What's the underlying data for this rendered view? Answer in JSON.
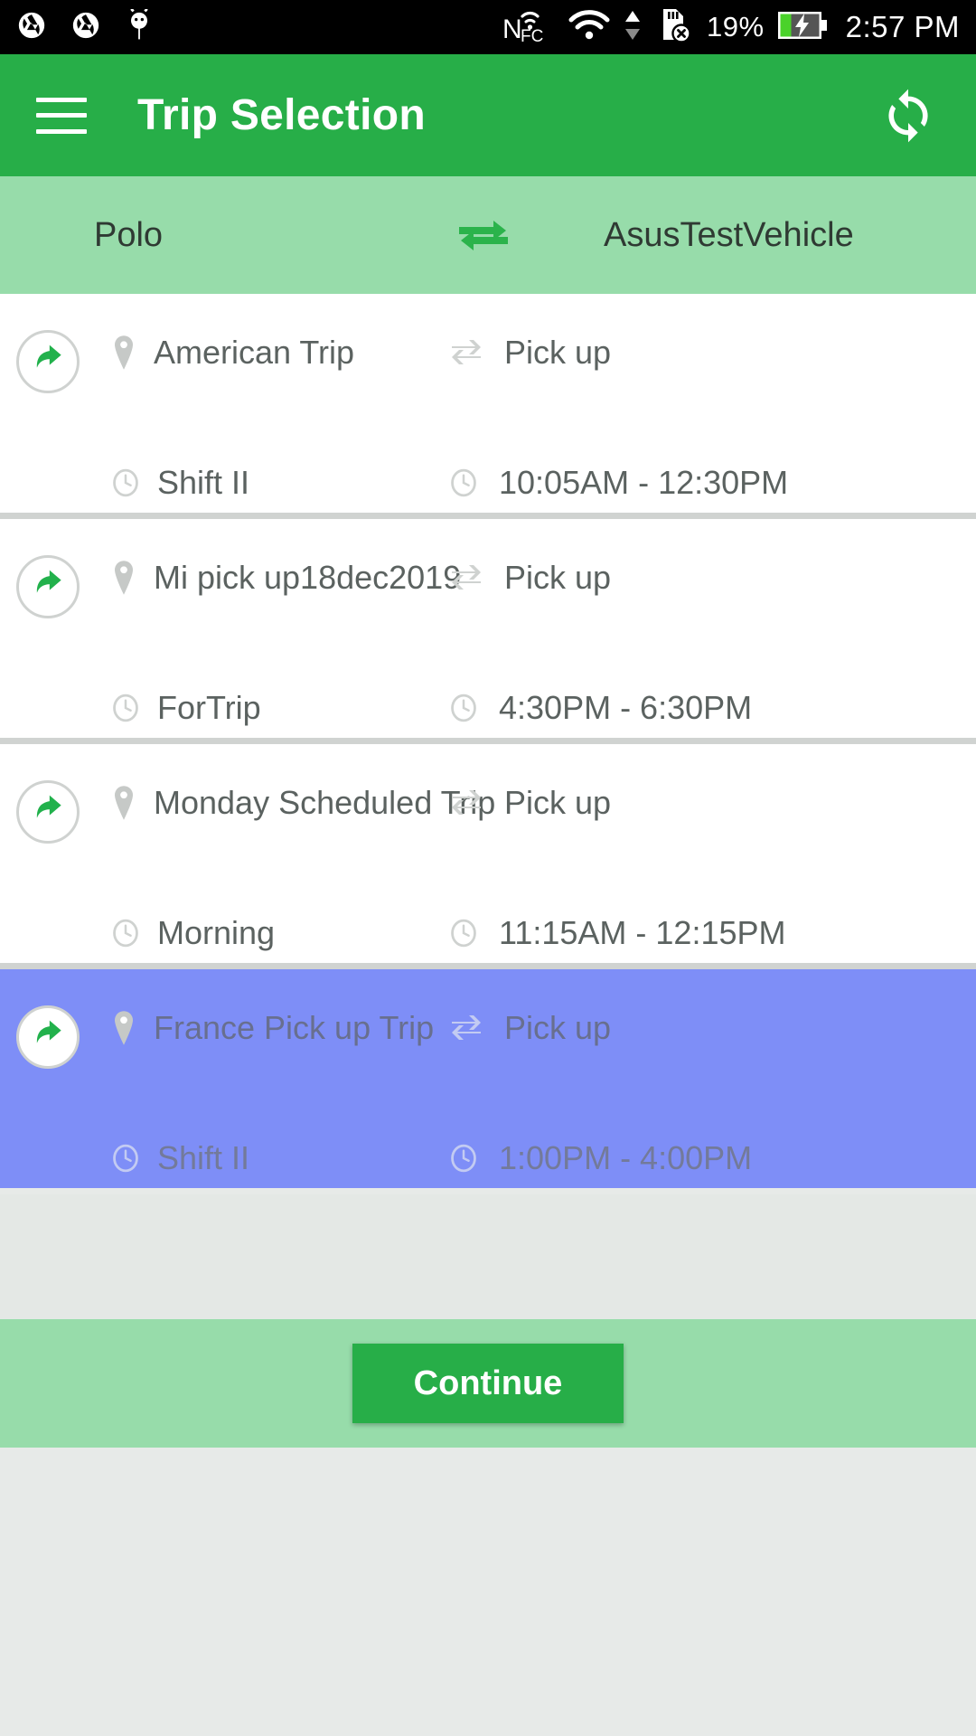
{
  "statusbar": {
    "icons_left": [
      "camera-aperture-icon",
      "camera-aperture-icon",
      "android-bug-icon"
    ],
    "icons_right": [
      "nfc-icon",
      "wifi-icon",
      "wifi-transfer-arrows-icon",
      "sd-card-error-icon"
    ],
    "battery_percent": "19%",
    "battery_state": "charging",
    "time": "2:57 PM"
  },
  "appbar": {
    "menu_icon": "hamburger-menu-icon",
    "title": "Trip Selection",
    "action_icon": "refresh-sync-icon",
    "background": "#27ae48"
  },
  "vehicle_band": {
    "from": "Polo",
    "to": "AsusTestVehicle",
    "swap_icon": "compare-arrows-icon",
    "background": "#97dcaa"
  },
  "trips": [
    {
      "name": "American Trip",
      "type": "Pick up",
      "shift": "Shift II",
      "time": "10:05AM - 12:30PM",
      "selected": false
    },
    {
      "name": "Mi pick up18dec2019",
      "type": "Pick up",
      "shift": "ForTrip",
      "time": "4:30PM - 6:30PM",
      "selected": false
    },
    {
      "name": "Monday Scheduled Trip",
      "type": "Pick up",
      "shift": "Morning",
      "time": "11:15AM - 12:15PM",
      "selected": false
    },
    {
      "name": "France Pick up Trip",
      "type": "Pick up",
      "shift": "Shift II",
      "time": "1:00PM - 4:00PM",
      "selected": true
    }
  ],
  "icons": {
    "trip_arrow": "curved-share-arrow-icon",
    "location": "map-pin-icon",
    "trip_type": "compare-arrows-icon",
    "clock": "clock-icon"
  },
  "footer": {
    "continue_label": "Continue",
    "button_color": "#27ae48",
    "background": "#97dcaa"
  },
  "colors": {
    "accent_green": "#27ae48",
    "light_green": "#97dcaa",
    "selected_blue": "#7e8ef7",
    "card_white": "#ffffff",
    "divider_gray": "#d0d3d1",
    "text_gray": "#5b6260"
  }
}
